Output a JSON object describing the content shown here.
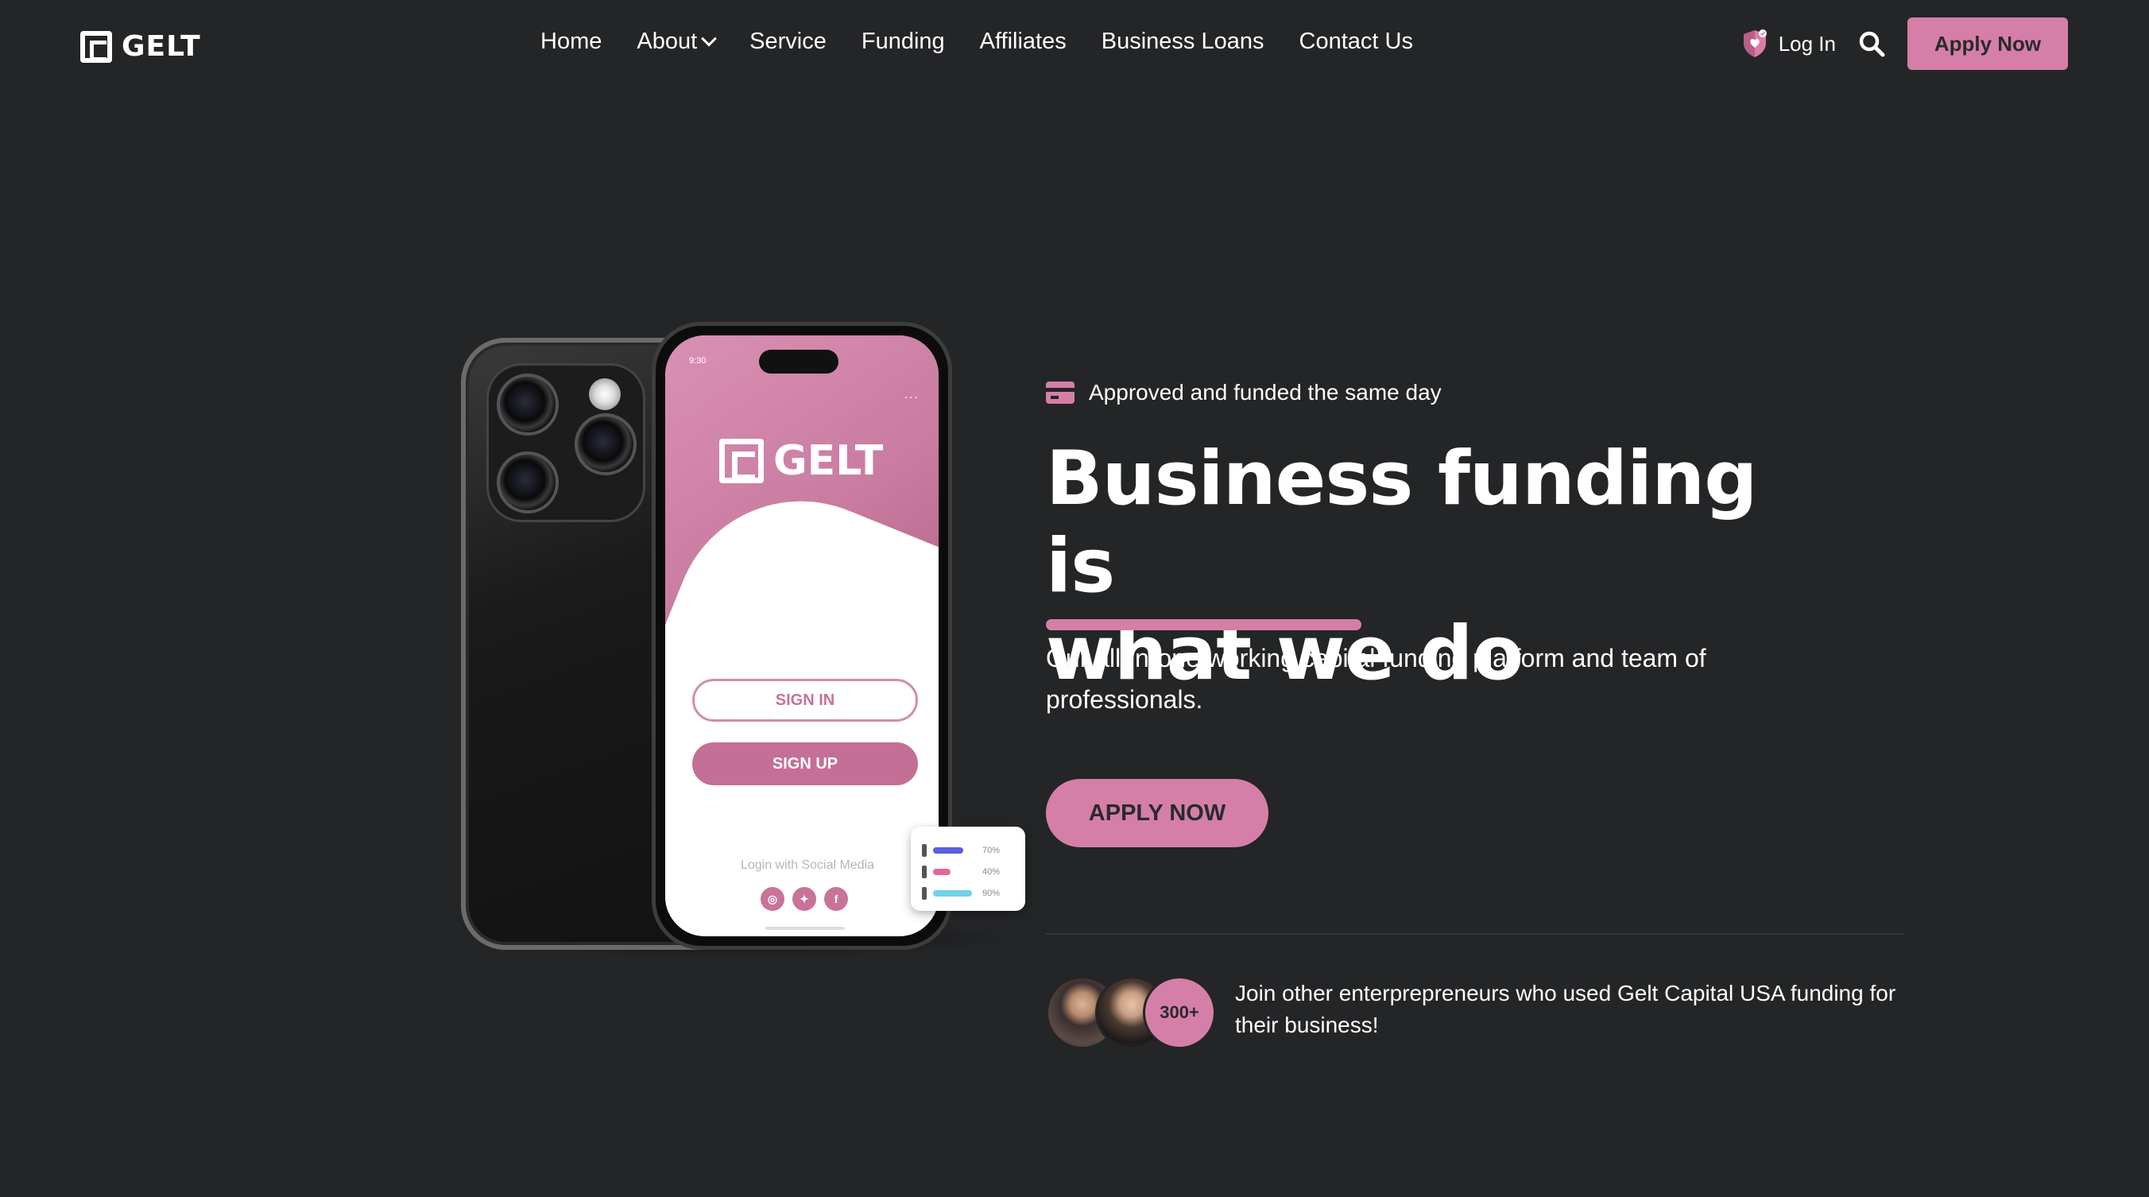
{
  "brand": {
    "name": "GELT"
  },
  "nav": {
    "items": [
      {
        "label": "Home"
      },
      {
        "label": "About",
        "has_dropdown": true
      },
      {
        "label": "Service"
      },
      {
        "label": "Funding"
      },
      {
        "label": "Affiliates"
      },
      {
        "label": "Business Loans"
      },
      {
        "label": "Contact Us"
      }
    ],
    "login_label": "Log In",
    "apply_label": "Apply Now",
    "icons": [
      "shield-heart-icon",
      "search-icon",
      "chevron-down-icon"
    ]
  },
  "hero": {
    "tagline": "Approved and funded the same day",
    "headline_line1": "Business funding is",
    "headline_line2": "what we do",
    "subtext": "Our all-in-one working capital funding platform and team of professionals.",
    "cta_label": "APPLY NOW",
    "social_proof_count": "300+",
    "social_proof_text": "Join other enterprepreneurs who used Gelt Capital USA funding for their business!"
  },
  "phone_screen": {
    "time": "9:30",
    "logo_text": "GELT",
    "menu_dots": "...",
    "signin_label": "SIGN IN",
    "signup_label": "SIGN UP",
    "social_label": "Login with Social Media",
    "social_icons": [
      "instagram-icon",
      "twitter-icon",
      "facebook-icon"
    ]
  },
  "stat_card": {
    "rows": [
      {
        "value": 70,
        "label": "70%",
        "color": "#5b5fe0"
      },
      {
        "value": 40,
        "label": "40%",
        "color": "#e0679b"
      },
      {
        "value": 90,
        "label": "90%",
        "color": "#6fd3e8"
      }
    ]
  },
  "colors": {
    "background": "#242527",
    "accent_pink": "#d57fa8",
    "text": "#ffffff"
  }
}
